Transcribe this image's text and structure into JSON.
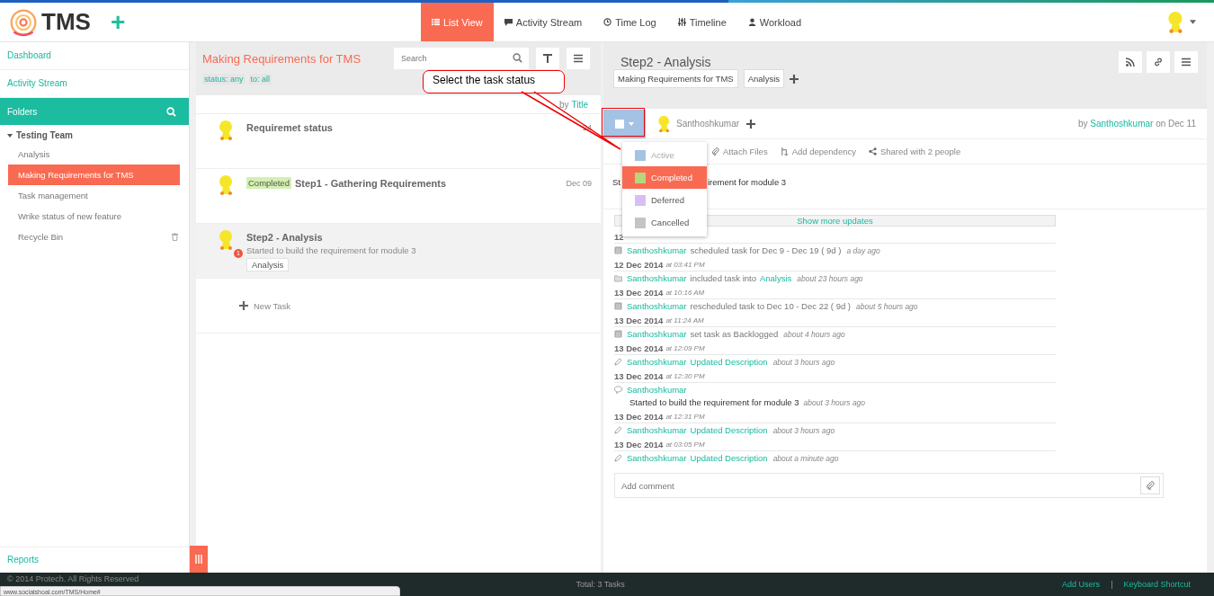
{
  "app": {
    "logo": "TMS",
    "plus": "+"
  },
  "nav": [
    {
      "label": "List View",
      "selected": true
    },
    {
      "label": "Activity Stream",
      "selected": false
    },
    {
      "label": "Time Log",
      "selected": false
    },
    {
      "label": "Timeline",
      "selected": false
    },
    {
      "label": "Workload",
      "selected": false
    }
  ],
  "sidebar": {
    "links": [
      "Dashboard",
      "Activity Stream"
    ],
    "folders_label": "Folders",
    "team": {
      "label": "Testing Team",
      "expanded": true,
      "children": [
        {
          "label": "Analysis",
          "selected": false
        },
        {
          "label": "Making Requirements for TMS",
          "selected": true
        },
        {
          "label": "Task management",
          "selected": false
        },
        {
          "label": "Wrike status of new feature",
          "selected": false
        },
        {
          "label": "Recycle Bin",
          "selected": false,
          "kind": "bin"
        }
      ]
    },
    "reports": "Reports"
  },
  "list": {
    "title": "Making Requirements for TMS",
    "search": {
      "placeholder": "Search"
    },
    "filters": [
      "status: any",
      "to: all"
    ],
    "sort": {
      "prefix": "by",
      "value": "Title"
    },
    "tasks": [
      {
        "title": "Requiremet status",
        "date": "24",
        "selected": false
      },
      {
        "title": "Step1 - Gathering Requirements",
        "status": "Completed",
        "date": "Dec 09",
        "selected": false
      },
      {
        "title": "Step2 - Analysis",
        "description": "Started to build the requirement for module 3",
        "tag": "Analysis",
        "badge": "1",
        "selected": true
      }
    ],
    "new_task": "New Task"
  },
  "detail": {
    "title": "Step2 - Analysis",
    "chips": [
      "Making Requirements for TMS",
      "Analysis"
    ],
    "assignee": "Santhoshkumar",
    "by": "by",
    "author": "Santhoshkumar",
    "on": "on Dec 11",
    "actions": [
      "Attach Files",
      "Add dependency",
      "Shared with 2 people"
    ],
    "description_parts": [
      "St",
      "irement for module 3"
    ],
    "show_more": "Show more updates",
    "activity": [
      {
        "date": "12"
      },
      {
        "kind": "schedule",
        "user": "Santhoshkumar",
        "text": "scheduled task for Dec 9 - Dec 19 ( 9d )",
        "ago": "a day ago"
      },
      {
        "date": "12 Dec 2014",
        "time": "at 03:41 PM"
      },
      {
        "kind": "folder",
        "user": "Santhoshkumar",
        "text": "included task into",
        "link": "Analysis",
        "ago": "about 23 hours ago"
      },
      {
        "date": "13 Dec 2014",
        "time": "at 10:16 AM"
      },
      {
        "kind": "schedule",
        "user": "Santhoshkumar",
        "text": "rescheduled task to Dec 10 - Dec 22 ( 9d )",
        "ago": "about 5 hours ago"
      },
      {
        "date": "13 Dec 2014",
        "time": "at 11:24 AM"
      },
      {
        "kind": "schedule",
        "user": "Santhoshkumar",
        "text": "set task as Backlogged",
        "ago": "about 4 hours ago"
      },
      {
        "date": "13 Dec 2014",
        "time": "at 12:09 PM"
      },
      {
        "kind": "edit",
        "user": "Santhoshkumar",
        "link": "Updated Description",
        "ago": "about 3 hours ago"
      },
      {
        "date": "13 Dec 2014",
        "time": "at 12:30 PM"
      },
      {
        "kind": "comment",
        "user": "Santhoshkumar",
        "comment": "Started to build the requirement for module 3",
        "ago": "about 3 hours ago"
      },
      {
        "date": "13 Dec 2014",
        "time": "at 12:31 PM"
      },
      {
        "kind": "edit",
        "user": "Santhoshkumar",
        "link": "Updated Description",
        "ago": "about 3 hours ago"
      },
      {
        "date": "13 Dec 2014",
        "time": "at 03:05 PM"
      },
      {
        "kind": "edit",
        "user": "Santhoshkumar",
        "link": "Updated Description",
        "ago": "about a minute ago"
      }
    ],
    "comment": {
      "placeholder": "Add comment"
    },
    "status_menu": [
      {
        "label": "Active",
        "color": "#a4c2e4",
        "selected": false
      },
      {
        "label": "Completed",
        "color": "#b5d77a",
        "selected": true
      },
      {
        "label": "Deferred",
        "color": "#d7bff5",
        "selected": false
      },
      {
        "label": "Cancelled",
        "color": "#c4c4c4",
        "selected": false
      }
    ]
  },
  "callout": {
    "text": "Select the task status"
  },
  "footer": {
    "copyright": "© 2014 Protech. All Rights Reserved",
    "total": "Total: 3 Tasks",
    "links": [
      "Add Users",
      "Keyboard Shortcut"
    ],
    "separator": "|"
  },
  "status_url": "www.socialshoal.com/TMS/Home#"
}
